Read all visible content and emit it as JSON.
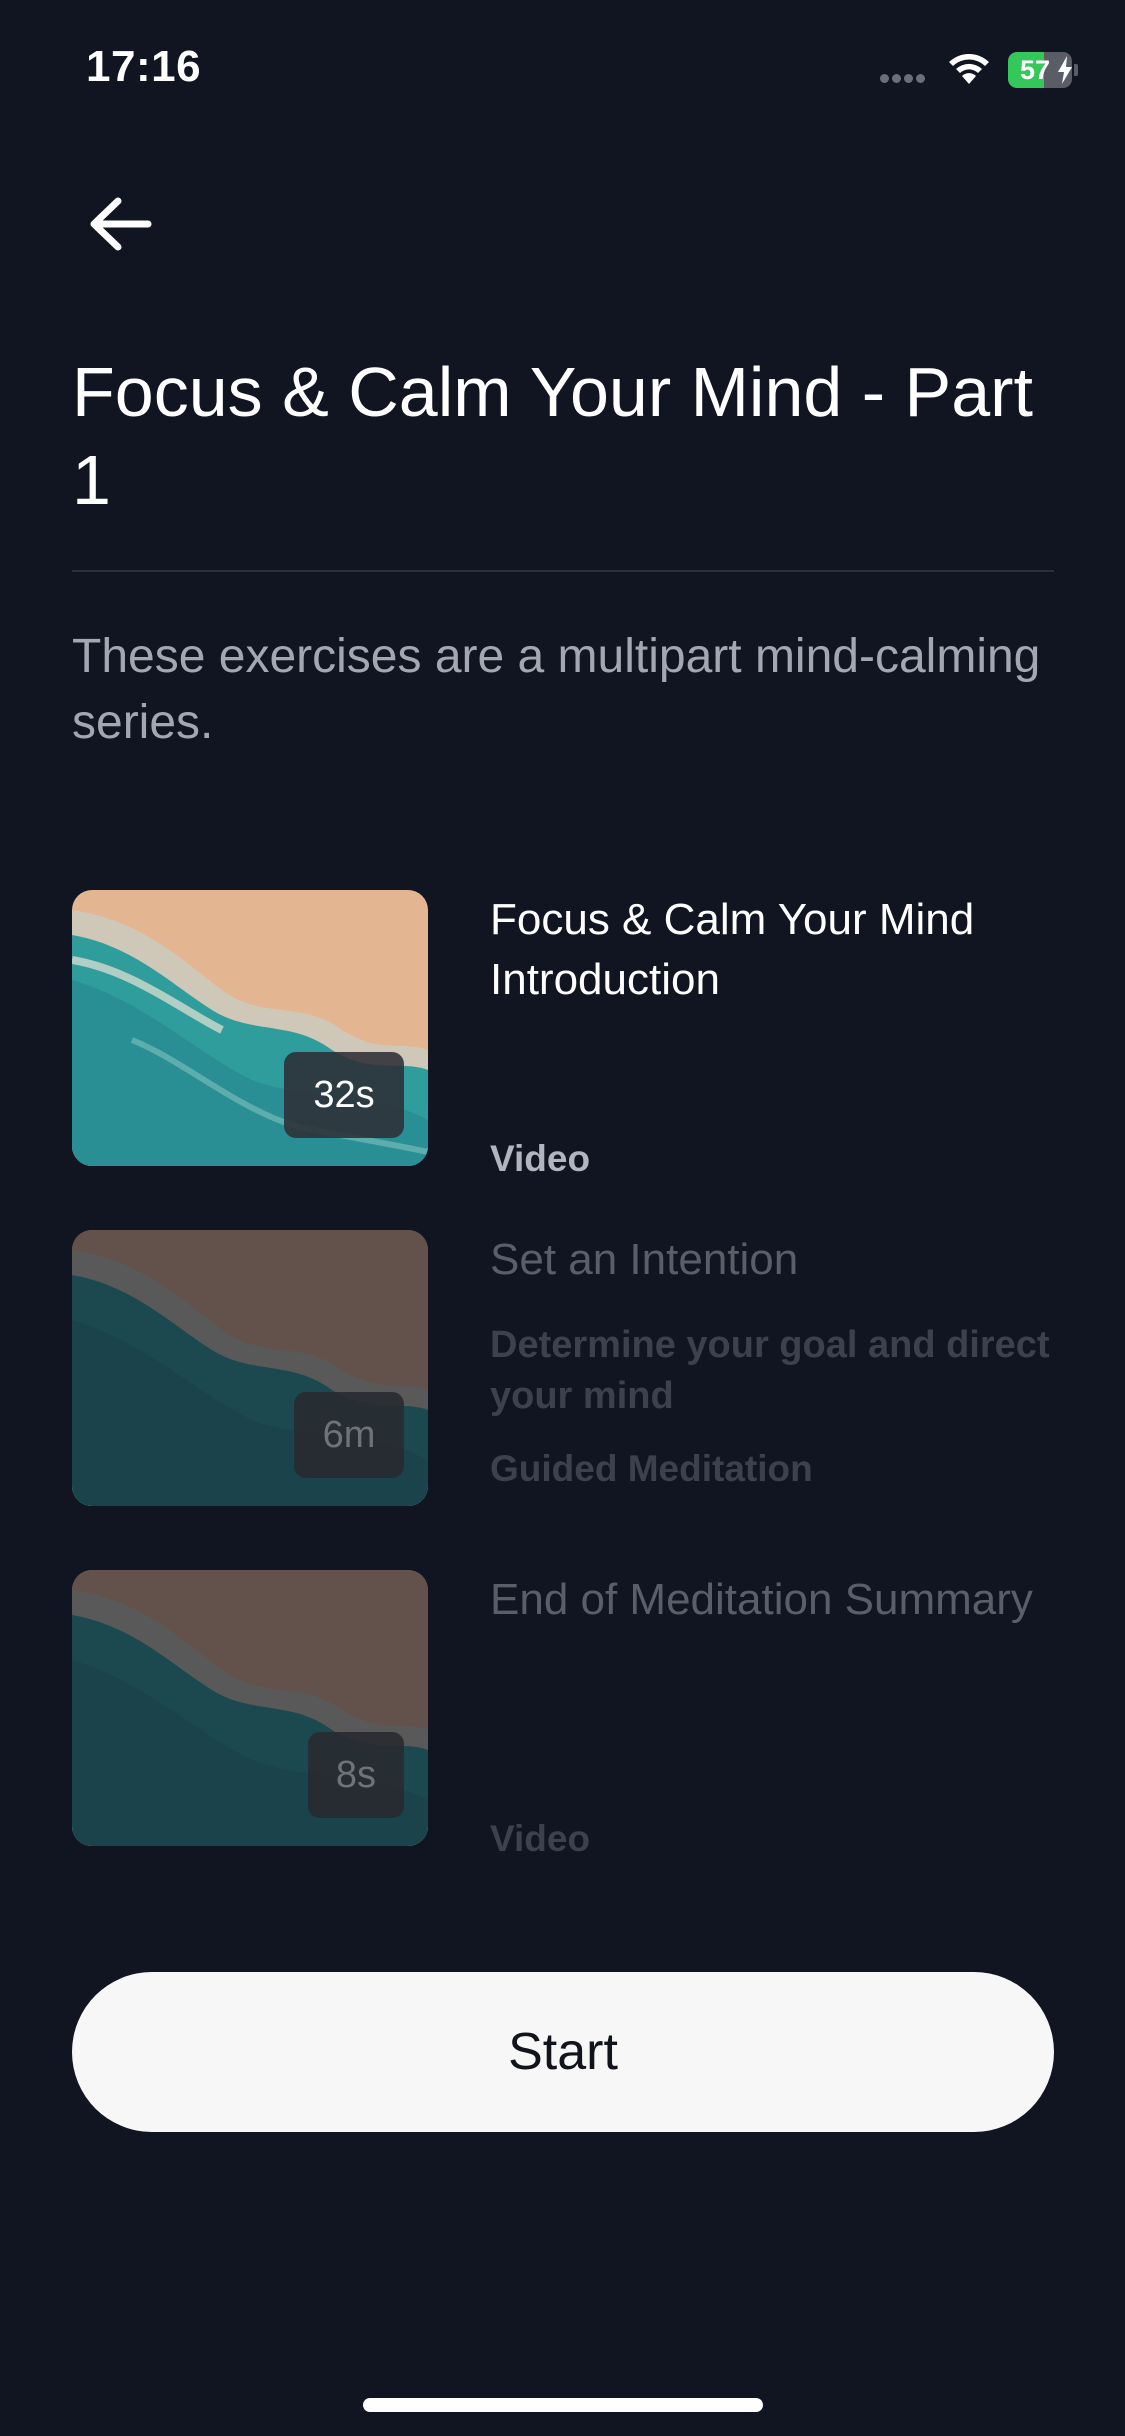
{
  "status_bar": {
    "time": "17:16",
    "battery_level": "57",
    "battery_fraction": 0.57,
    "icons": [
      "cellular-signal-icon",
      "wifi-icon",
      "battery-charging-icon"
    ]
  },
  "header": {
    "back_icon": "arrow-left-icon",
    "title": "Focus & Calm Your Mind - Part 1",
    "description": "These exercises are a multipart mind-calming series."
  },
  "sessions": [
    {
      "title": "Focus & Calm Your Mind Introduction",
      "subtitle": "",
      "type": "Video",
      "duration": "32s",
      "active": true
    },
    {
      "title": "Set an Intention",
      "subtitle": "Determine your goal and direct your mind",
      "type": "Guided Meditation",
      "duration": "6m",
      "active": false
    },
    {
      "title": "End of Meditation Summary",
      "subtitle": "",
      "type": "Video",
      "duration": "8s",
      "active": false
    }
  ],
  "footer": {
    "start_label": "Start"
  },
  "colors": {
    "background": "#111521",
    "primary_text": "#ffffff",
    "secondary_text": "#a3a7b1",
    "button_bg": "#f7f7f8",
    "battery_green": "#34c759",
    "sand": "#e0b08c",
    "sea": "#2a9a9a"
  }
}
